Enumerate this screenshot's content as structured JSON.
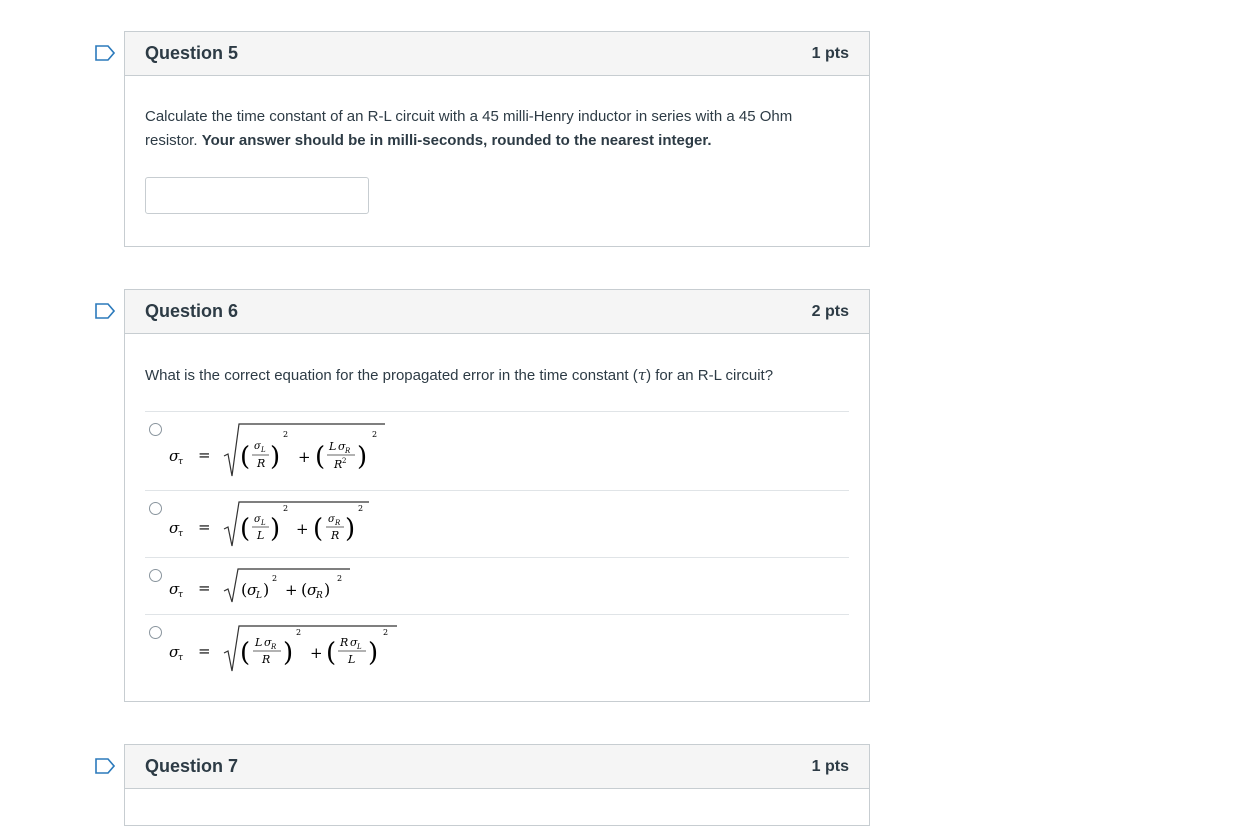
{
  "questions": [
    {
      "title": "Question 5",
      "points": "1 pts",
      "text_plain": "Calculate the time constant of an R-L circuit with a 45 milli-Henry inductor in series with a 45 Ohm resistor.",
      "text_bold": "Your answer should be in milli-seconds, rounded to the nearest integer.",
      "answer_value": ""
    },
    {
      "title": "Question 6",
      "points": "2 pts",
      "text_before": "What is the correct equation for the propagated error in the time constant (",
      "text_symbol": "τ",
      "text_after": ") for an R-L circuit?",
      "options": [
        {
          "formula": "σ_τ = √( (σ_L / R)² + (L σ_R / R²)² )"
        },
        {
          "formula": "σ_τ = √( (σ_L / L)² + (σ_R / R)² )"
        },
        {
          "formula": "σ_τ = √( (σ_L)² + (σ_R)² )"
        },
        {
          "formula": "σ_τ = √( (L σ_R / R)² + (R σ_L / L)² )"
        }
      ]
    },
    {
      "title": "Question 7",
      "points": "1 pts"
    }
  ],
  "icons": {
    "flag": "bookmark-flag-icon",
    "radio": "radio-button-icon"
  },
  "colors": {
    "flag": "#2b7abc",
    "border": "#c7cdd1",
    "header_bg": "#f5f5f5",
    "text": "#2d3b45"
  }
}
